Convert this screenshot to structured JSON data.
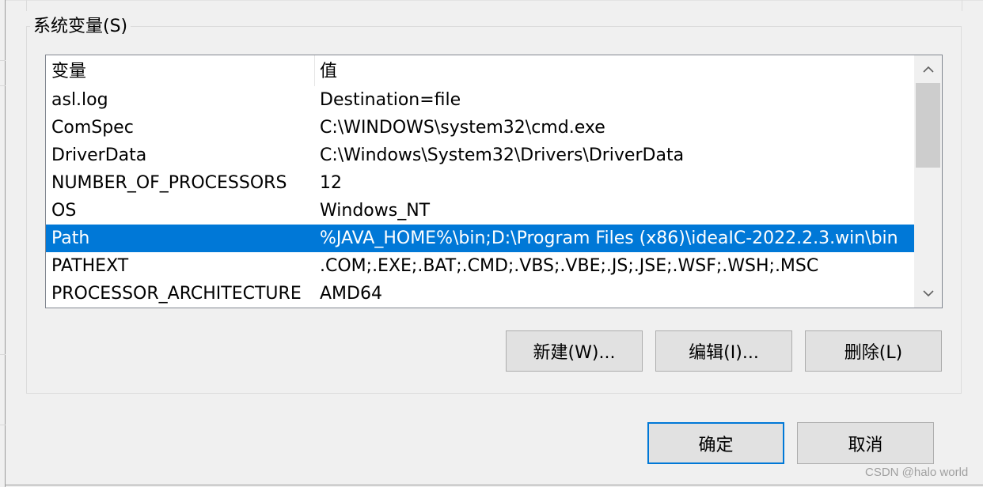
{
  "group_title": "系统变量(S)",
  "list": {
    "columns": [
      "变量",
      "值"
    ],
    "rows": [
      {
        "name": "asl.log",
        "value": "Destination=file",
        "selected": false
      },
      {
        "name": "ComSpec",
        "value": "C:\\WINDOWS\\system32\\cmd.exe",
        "selected": false
      },
      {
        "name": "DriverData",
        "value": "C:\\Windows\\System32\\Drivers\\DriverData",
        "selected": false
      },
      {
        "name": "NUMBER_OF_PROCESSORS",
        "value": "12",
        "selected": false
      },
      {
        "name": "OS",
        "value": "Windows_NT",
        "selected": false
      },
      {
        "name": "Path",
        "value": "%JAVA_HOME%\\bin;D:\\Program Files (x86)\\ideaIC-2022.2.3.win\\bin",
        "selected": true
      },
      {
        "name": "PATHEXT",
        "value": ".COM;.EXE;.BAT;.CMD;.VBS;.VBE;.JS;.JSE;.WSF;.WSH;.MSC",
        "selected": false
      },
      {
        "name": "PROCESSOR_ARCHITECTURE",
        "value": "AMD64",
        "selected": false
      }
    ]
  },
  "buttons": {
    "new": "新建(W)...",
    "edit": "编辑(I)...",
    "delete": "删除(L)",
    "ok": "确定",
    "cancel": "取消"
  },
  "watermark": "CSDN @halo world",
  "colors": {
    "selection": "#0078d7",
    "default_button_border": "#0078d7",
    "button_face": "#e1e1e1"
  }
}
